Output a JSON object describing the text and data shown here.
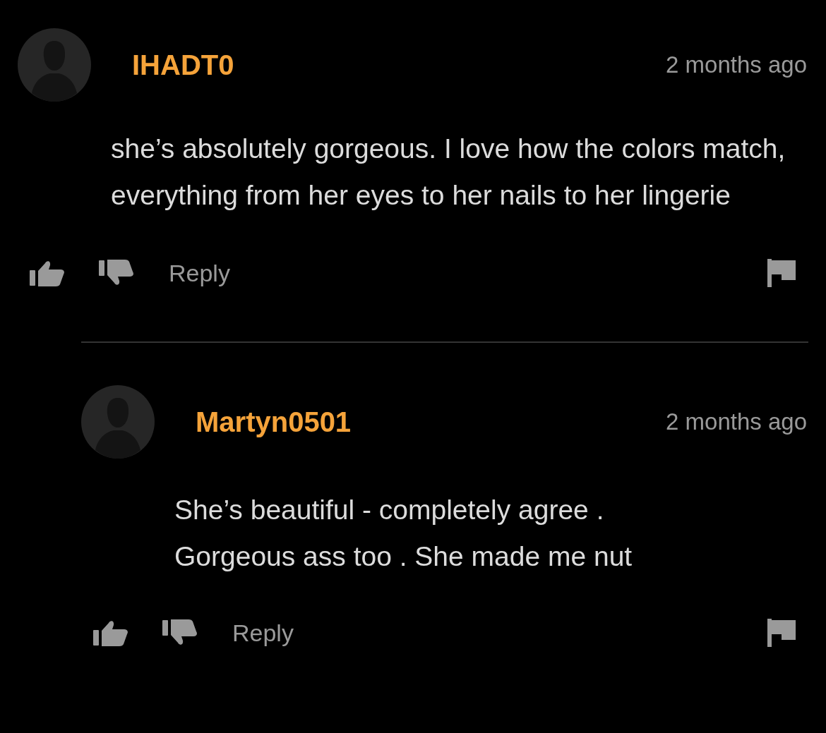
{
  "comments": [
    {
      "username": "IHADT0",
      "time": "2 months ago",
      "text": "she’s absolutely gorgeous. I love how the colors match, everything from her eyes to her nails to her lingerie",
      "reply_label": "Reply",
      "replies": [
        {
          "username": "Martyn0501",
          "time": "2 months ago",
          "text": "She’s beautiful - completely agree . Gorgeous ass too . She made me nut",
          "reply_label": "Reply"
        }
      ]
    }
  ]
}
